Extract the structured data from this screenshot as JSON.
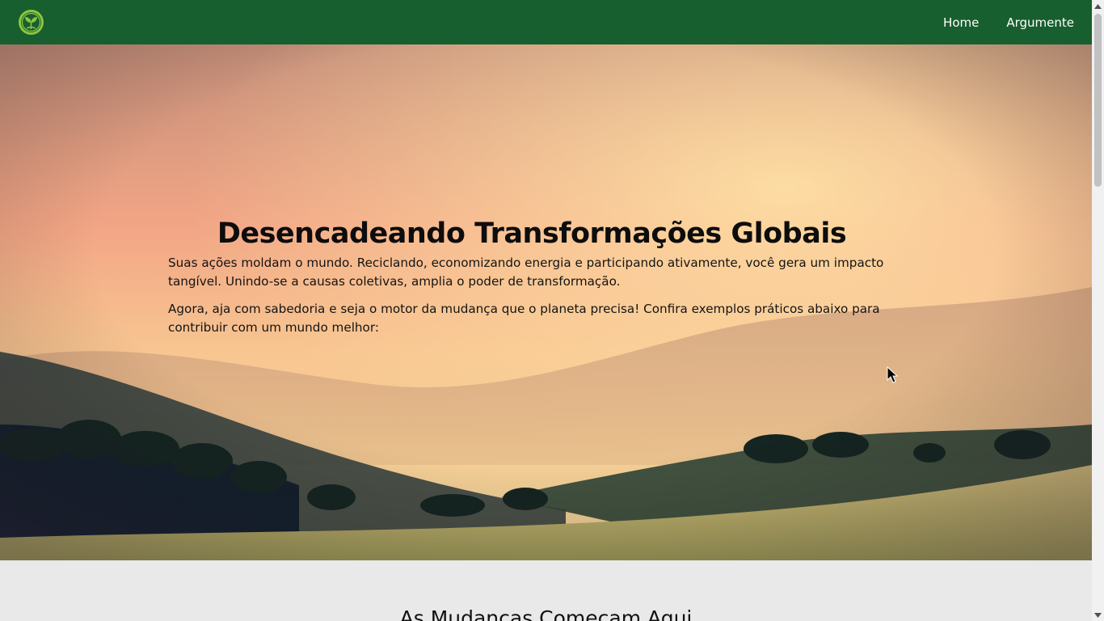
{
  "navbar": {
    "logo_icon": "leaf-sprout-icon",
    "links": [
      {
        "label": "Home"
      },
      {
        "label": "Argumente"
      }
    ]
  },
  "hero": {
    "title": "Desencadeando Transformações Globais",
    "paragraph1": "Suas ações moldam o mundo. Reciclando, economizando energia e participando ativamente, você gera um impacto tangível. Unindo-se a causas coletivas, amplia o poder de transformação.",
    "paragraph2": "Agora, aja com sabedoria e seja o motor da mudança que o planeta precisa! Confira exemplos práticos abaixo para contribuir com um mundo melhor:"
  },
  "section2": {
    "title": "As Mudanças Começam Aqui"
  },
  "colors": {
    "navbar": "#175f2e",
    "section_bg": "#e8e9e8"
  }
}
